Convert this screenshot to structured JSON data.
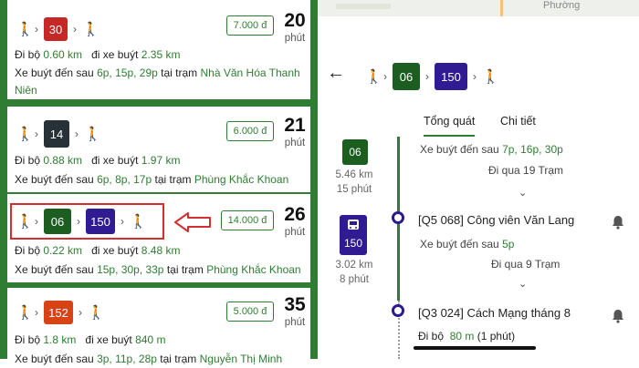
{
  "left_panel": {
    "walk_label": "đi bộ",
    "walk_label_cap": "Đi bộ",
    "bus_label": "đi xe buýt",
    "next_bus_label": "Xe buýt đến sau",
    "at_station_label": "tại trạm",
    "minutes_unit": "phút",
    "routes": [
      {
        "badges": [
          {
            "number": "30",
            "color": "#c62828"
          }
        ],
        "fare": "7.000 đ",
        "duration": "20",
        "walk_distance": "0.60 km",
        "bus_distance": "2.35 km",
        "next_times": "6p, 15p, 29p",
        "station": "Nhà Văn Hóa Thanh Niên"
      },
      {
        "badges": [
          {
            "number": "14",
            "color": "#263238"
          }
        ],
        "fare": "6.000 đ",
        "duration": "21",
        "walk_distance": "0.88 km",
        "bus_distance": "1.97 km",
        "next_times": "6p, 8p, 17p",
        "station": "Phùng Khắc Khoan"
      },
      {
        "badges": [
          {
            "number": "06",
            "color": "#1b5e20"
          },
          {
            "number": "150",
            "color": "#311b92"
          }
        ],
        "fare": "14.000 đ",
        "duration": "26",
        "walk_distance": "0.22 km",
        "bus_distance": "8.48 km",
        "next_times": "15p, 30p, 33p",
        "station": "Phùng Khắc Khoan"
      },
      {
        "badges": [
          {
            "number": "152",
            "color": "#d84315"
          }
        ],
        "fare": "5.000 đ",
        "duration": "35",
        "walk_distance": "1.8 km",
        "bus_distance": "840 m",
        "next_times": "3p, 11p, 28p",
        "station": "Nguyễn Thị Minh"
      }
    ]
  },
  "right_panel": {
    "map_label": "Phường",
    "route_badges": [
      {
        "number": "06",
        "color": "#1b5e20"
      },
      {
        "number": "150",
        "color": "#311b92"
      }
    ],
    "tabs": [
      {
        "label": "Tổng quát",
        "active": true
      },
      {
        "label": "Chi tiết",
        "active": false
      }
    ],
    "leg1": {
      "badge": "06",
      "distance": "5.46 km",
      "time": "15 phút",
      "next_label": "Xe buýt đến sau",
      "next_times": "7p, 16p, 30p",
      "stops": "Đi qua 19 Trạm"
    },
    "stop1": "[Q5 068] Công viên Văn Lang",
    "leg2": {
      "badge": "150",
      "distance": "3.02 km",
      "time": "8 phút",
      "next_label": "Xe buýt đến sau",
      "next_times": "5p",
      "stops": "Đi qua 9 Trạm"
    },
    "stop2": "[Q3 024] Cách Mạng tháng 8",
    "walk": {
      "label": "Đi bộ",
      "distance": "80 m",
      "time": "(1 phút)"
    }
  }
}
